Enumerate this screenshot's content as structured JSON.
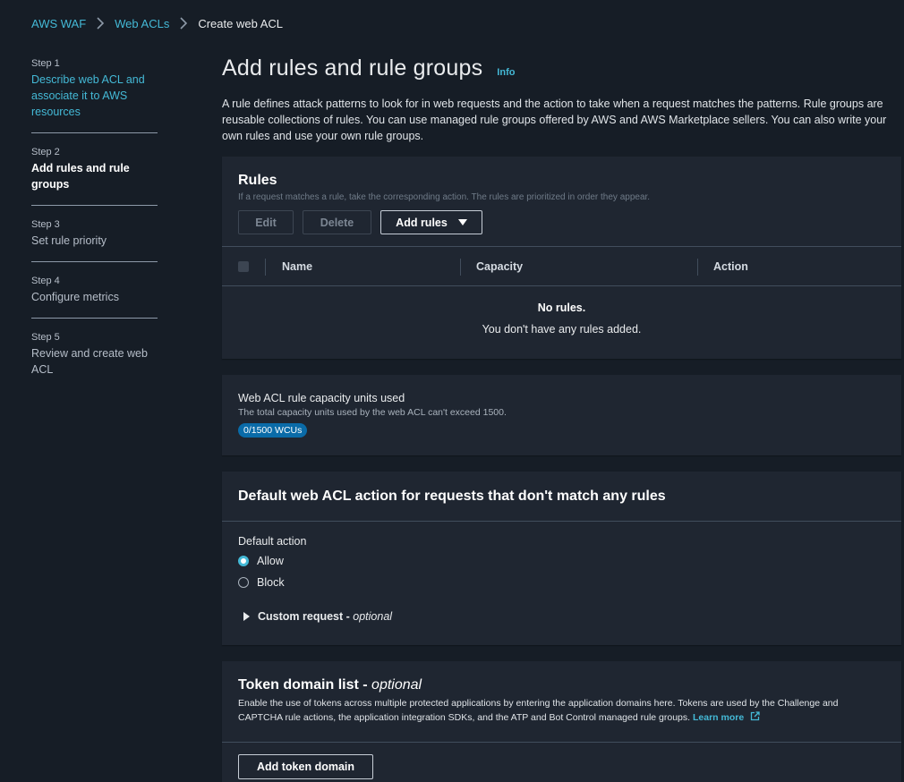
{
  "breadcrumb": {
    "items": [
      "AWS WAF",
      "Web ACLs"
    ],
    "current": "Create web ACL"
  },
  "steps": [
    {
      "num": "Step 1",
      "title": "Describe web ACL and associate it to AWS resources"
    },
    {
      "num": "Step 2",
      "title": "Add rules and rule groups"
    },
    {
      "num": "Step 3",
      "title": "Set rule priority"
    },
    {
      "num": "Step 4",
      "title": "Configure metrics"
    },
    {
      "num": "Step 5",
      "title": "Review and create web ACL"
    }
  ],
  "page": {
    "title": "Add rules and rule groups",
    "info": "Info",
    "description": "A rule defines attack patterns to look for in web requests and the action to take when a request matches the patterns. Rule groups are reusable collections of rules. You can use managed rule groups offered by AWS and AWS Marketplace sellers. You can also write your own rules and use your own rule groups."
  },
  "rules": {
    "title": "Rules",
    "subtitle": "If a request matches a rule, take the corresponding action. The rules are prioritized in order they appear.",
    "edit": "Edit",
    "delete": "Delete",
    "add_rules": "Add rules",
    "columns": [
      "Name",
      "Capacity",
      "Action"
    ],
    "empty_title": "No rules.",
    "empty_desc": "You don't have any rules added."
  },
  "capacity": {
    "title": "Web ACL rule capacity units used",
    "subtitle": "The total capacity units used by the web ACL can't exceed 1500.",
    "badge": "0/1500 WCUs"
  },
  "default_action": {
    "title": "Default web ACL action for requests that don't match any rules",
    "label": "Default action",
    "options": [
      "Allow",
      "Block"
    ],
    "selected": "Allow",
    "custom_request": "Custom request - ",
    "optional": "optional"
  },
  "token": {
    "title": "Token domain list - ",
    "optional": "optional",
    "description": "Enable the use of tokens across multiple protected applications by entering the application domains here. Tokens are used by the Challenge and CAPTCHA rule actions, the application integration SDKs, and the ATP and Bot Control managed rule groups. ",
    "learn_more": "Learn more",
    "add_button": "Add token domain"
  }
}
